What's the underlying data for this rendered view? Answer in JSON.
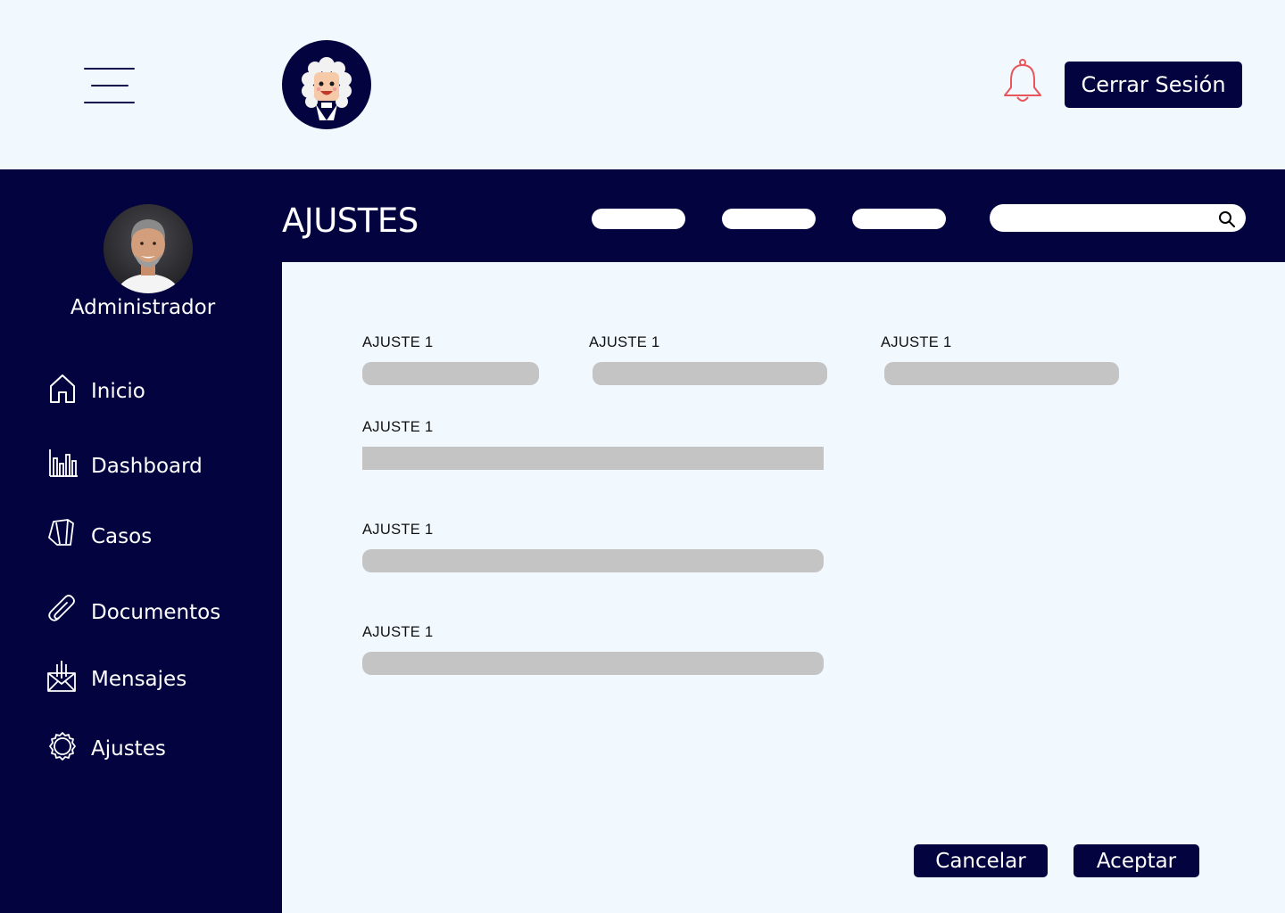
{
  "topbar": {
    "menu_icon": "hamburger-menu-icon",
    "logo_icon": "judge-avatar-logo",
    "notification_icon": "bell-icon",
    "logout_label": "Cerrar Sesión"
  },
  "sidebar": {
    "role": "Administrador",
    "avatar_icon": "user-avatar",
    "items": [
      {
        "label": "Inicio",
        "icon": "home-icon"
      },
      {
        "label": "Dashboard",
        "icon": "bar-chart-icon"
      },
      {
        "label": "Casos",
        "icon": "cases-icon"
      },
      {
        "label": "Documentos",
        "icon": "paperclip-icon"
      },
      {
        "label": "Mensajes",
        "icon": "mail-icon"
      },
      {
        "label": "Ajustes",
        "icon": "gear-icon"
      }
    ]
  },
  "header": {
    "title": "AJUSTES",
    "search_icon": "search-icon"
  },
  "form": {
    "fields": [
      {
        "label": "AJUSTE 1",
        "value": ""
      },
      {
        "label": "AJUSTE 1",
        "value": ""
      },
      {
        "label": "AJUSTE 1",
        "value": ""
      },
      {
        "label": "AJUSTE 1",
        "value": ""
      },
      {
        "label": "AJUSTE 1",
        "value": ""
      },
      {
        "label": "AJUSTE 1",
        "value": ""
      }
    ]
  },
  "actions": {
    "cancel_label": "Cancelar",
    "accept_label": "Aceptar"
  },
  "colors": {
    "navy": "#02033F",
    "background": "#F1F8FE",
    "field_gray": "#C4C4C4",
    "bell_red": "#E8555A"
  }
}
